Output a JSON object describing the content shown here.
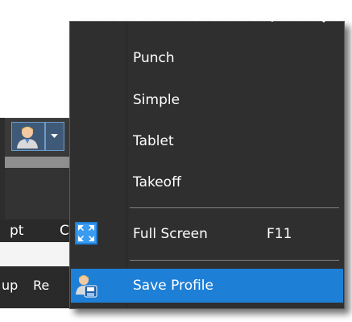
{
  "background_app": {
    "tabs_fragment": [
      "pt",
      "C"
    ],
    "bottom_fragment": [
      "up",
      "Re"
    ]
  },
  "menu": {
    "items": [
      {
        "label": "Punch"
      },
      {
        "label": "Simple"
      },
      {
        "label": "Tablet"
      },
      {
        "label": "Takeoff"
      },
      {
        "label": "Full Screen",
        "shortcut": "F11",
        "icon": "fullscreen-icon"
      },
      {
        "label": "Save Profile",
        "icon": "save-profile-icon",
        "selected": true
      }
    ]
  },
  "colors": {
    "menu_background": "#2f2f2f",
    "selection": "#1e7fd6",
    "text": "#ffffff"
  }
}
